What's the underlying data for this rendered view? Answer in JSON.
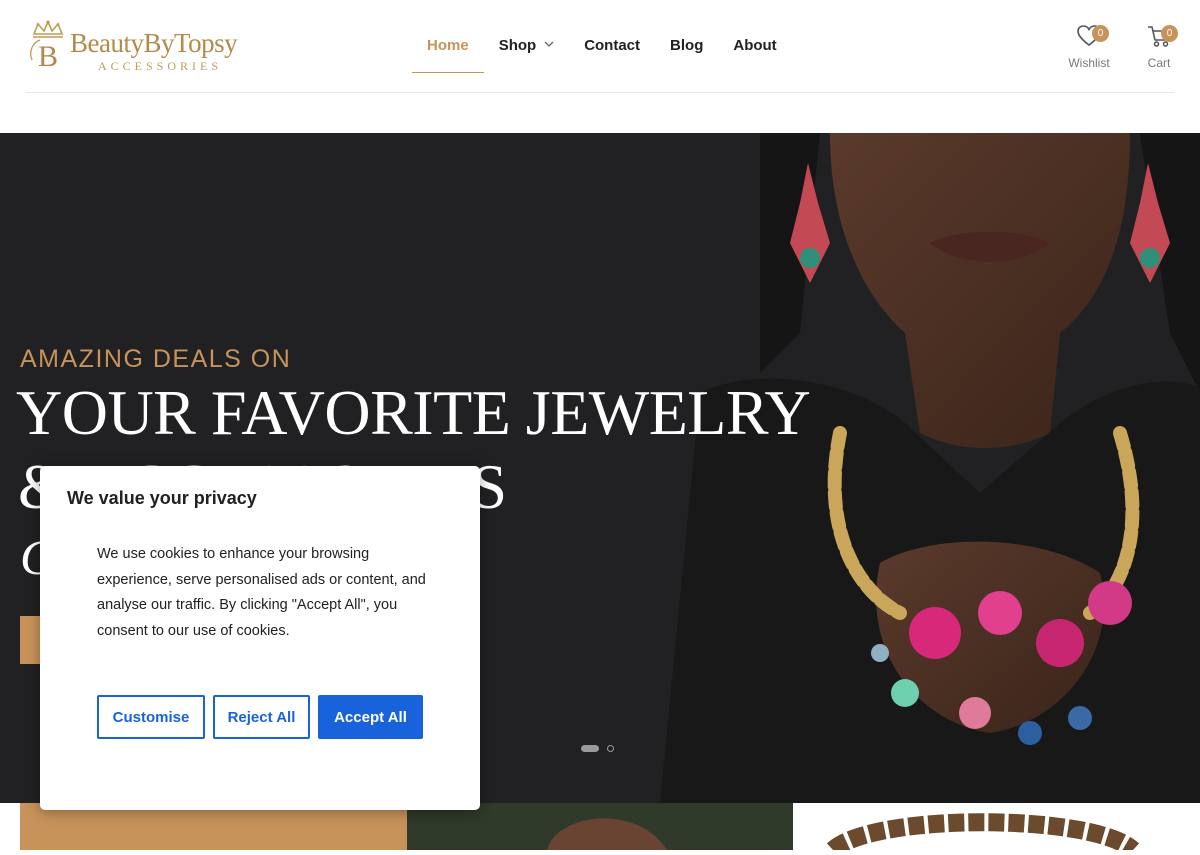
{
  "logo": {
    "name": "BeautyByTopsy",
    "tagline": "ACCESSORIES"
  },
  "nav": {
    "items": [
      {
        "label": "Home",
        "active": true
      },
      {
        "label": "Shop",
        "has_dropdown": true
      },
      {
        "label": "Contact"
      },
      {
        "label": "Blog"
      },
      {
        "label": "About"
      }
    ]
  },
  "header_tools": {
    "wishlist": {
      "label": "Wishlist",
      "count": "0"
    },
    "cart": {
      "label": "Cart",
      "count": "0"
    }
  },
  "hero": {
    "eyebrow": "AMAZING DEALS ON",
    "title": "YOUR FAVORITE JEWELRY",
    "title_line2": "& ACCESSORIES",
    "slides": 2,
    "active_slide": 1
  },
  "cookie_banner": {
    "title": "We value your privacy",
    "text": "We use cookies to enhance your browsing experience, serve personalised ads or content, and analyse our traffic. By clicking \"Accept All\", you consent to our use of cookies.",
    "buttons": {
      "customise": "Customise",
      "reject": "Reject All",
      "accept": "Accept All"
    }
  },
  "colors": {
    "accent": "#c8935a",
    "primary_button": "#1863dc",
    "hero_bg": "#212123"
  }
}
